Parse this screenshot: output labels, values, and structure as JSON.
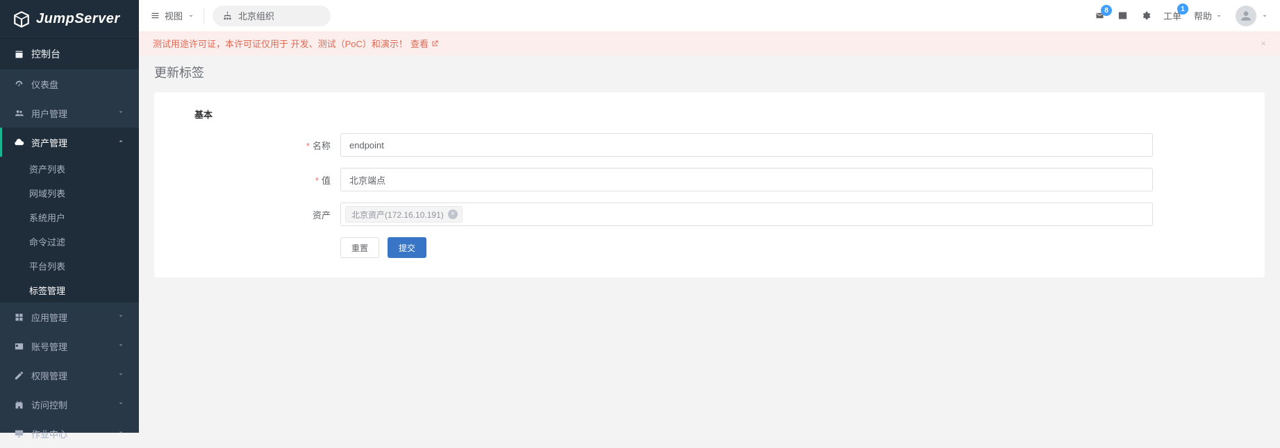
{
  "brand": "JumpServer",
  "sidebar": {
    "console": "控制台",
    "items": [
      {
        "label": "仪表盘"
      },
      {
        "label": "用户管理"
      },
      {
        "label": "资产管理"
      },
      {
        "label": "应用管理"
      },
      {
        "label": "账号管理"
      },
      {
        "label": "权限管理"
      },
      {
        "label": "访问控制"
      },
      {
        "label": "作业中心"
      }
    ],
    "asset_sub": [
      {
        "label": "资产列表"
      },
      {
        "label": "网域列表"
      },
      {
        "label": "系统用户"
      },
      {
        "label": "命令过滤"
      },
      {
        "label": "平台列表"
      },
      {
        "label": "标签管理"
      }
    ]
  },
  "topbar": {
    "view_label": "视图",
    "org_name": "北京组织",
    "mail_badge": "8",
    "ticket_badge": "1",
    "ticket_label": "工单",
    "help_label": "帮助"
  },
  "alert": {
    "text": "测试用途许可证，本许可证仅用于 开发、测试（PoC）和演示！",
    "link": "查看"
  },
  "page": {
    "title": "更新标签",
    "section": "基本",
    "labels": {
      "name": "名称",
      "value": "值",
      "asset": "资产"
    },
    "form": {
      "name": "endpoint",
      "value": "北京端点",
      "asset_tag": "北京资产(172.16.10.191)"
    },
    "buttons": {
      "reset": "重置",
      "submit": "提交"
    }
  }
}
